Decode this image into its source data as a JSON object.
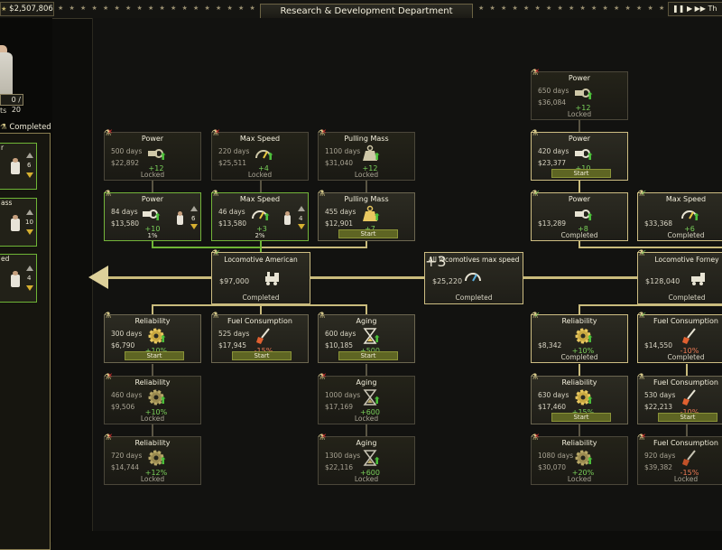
{
  "topbar": {
    "money": "$2,507,806",
    "title": "Research & Development Department",
    "right_label": "Th"
  },
  "left_panel": {
    "staff_count": "0 / 20",
    "text_fragment": "ts",
    "completed_label": "Completed",
    "cards": [
      {
        "title": "r",
        "level": "6"
      },
      {
        "title": "ass",
        "level": "10"
      },
      {
        "title": "ed",
        "level": "4"
      }
    ]
  },
  "nodes": {
    "power_locked": {
      "title": "Power",
      "days": "500 days",
      "cost": "$22,892",
      "gain": "+12",
      "status": "Locked"
    },
    "maxspeed_locked": {
      "title": "Max Speed",
      "days": "220 days",
      "cost": "$25,511",
      "gain": "+4",
      "status": "Locked"
    },
    "pulling_locked": {
      "title": "Pulling Mass",
      "days": "1100 days",
      "cost": "$31,040",
      "gain": "+12",
      "status": "Locked"
    },
    "power_active": {
      "title": "Power",
      "days": "84 days",
      "cost": "$13,580",
      "gain": "+10",
      "staff": "6",
      "progress": "1%"
    },
    "maxspeed_active": {
      "title": "Max Speed",
      "days": "46 days",
      "cost": "$13,580",
      "gain": "+3",
      "staff": "4",
      "progress": "2%"
    },
    "pulling_start": {
      "title": "Pulling Mass",
      "days": "455 days",
      "cost": "$12,901",
      "gain": "+7",
      "button": "Start"
    },
    "loco_american": {
      "title": "Locomotive American",
      "cost": "$97,000",
      "status": "Completed"
    },
    "all_loco": {
      "title": "All locomotives max speed",
      "cost": "$25,220",
      "gain": "+3",
      "status": "Completed"
    },
    "loco_forney": {
      "title": "Locomotive Forney",
      "cost": "$128,040",
      "status": "Completed"
    },
    "rel_start": {
      "title": "Reliability",
      "days": "300 days",
      "cost": "$6,790",
      "gain": "+10%",
      "button": "Start"
    },
    "fuel_start": {
      "title": "Fuel Consumption",
      "days": "525 days",
      "cost": "$17,945",
      "gain": "-15%",
      "button": "Start"
    },
    "aging_start": {
      "title": "Aging",
      "days": "600 days",
      "cost": "$10,185",
      "gain": "+500",
      "button": "Start"
    },
    "rel_locked1": {
      "title": "Reliability",
      "days": "460 days",
      "cost": "$9,506",
      "gain": "+10%",
      "status": "Locked"
    },
    "aging_locked1": {
      "title": "Aging",
      "days": "1000 days",
      "cost": "$17,169",
      "gain": "+600",
      "status": "Locked"
    },
    "rel_locked2": {
      "title": "Reliability",
      "days": "720 days",
      "cost": "$14,744",
      "gain": "+12%",
      "status": "Locked"
    },
    "aging_locked2": {
      "title": "Aging",
      "days": "1300 days",
      "cost": "$22,116",
      "gain": "+600",
      "status": "Locked"
    },
    "r_power_locked": {
      "title": "Power",
      "days": "650 days",
      "cost": "$36,084",
      "gain": "+12",
      "status": "Locked"
    },
    "r_power_start": {
      "title": "Power",
      "days": "420 days",
      "cost": "$23,377",
      "gain": "+10",
      "button": "Start"
    },
    "r_power_done": {
      "title": "Power",
      "cost": "$13,289",
      "gain": "+8",
      "status": "Completed"
    },
    "r_maxspeed_done": {
      "title": "Max Speed",
      "cost": "$33,368",
      "gain": "+6",
      "status": "Completed"
    },
    "r_rel_done": {
      "title": "Reliability",
      "cost": "$8,342",
      "gain": "+10%",
      "status": "Completed"
    },
    "r_fuel_done": {
      "title": "Fuel Consumption",
      "cost": "$14,550",
      "gain": "-10%",
      "status": "Completed"
    },
    "r_rel_start": {
      "title": "Reliability",
      "days": "630 days",
      "cost": "$17,460",
      "gain": "+15%",
      "button": "Start"
    },
    "r_fuel_start": {
      "title": "Fuel Consumption",
      "days": "530 days",
      "cost": "$22,213",
      "gain": "-10%",
      "button": "Start"
    },
    "r_rel_locked": {
      "title": "Reliability",
      "days": "1080 days",
      "cost": "$30,070",
      "gain": "+20%",
      "status": "Locked"
    },
    "r_fuel_locked": {
      "title": "Fuel Consumption",
      "days": "920 days",
      "cost": "$39,382",
      "gain": "-15%",
      "status": "Locked"
    }
  },
  "colors": {
    "accent_gold": "#cdbd82",
    "active_green": "#74b43a",
    "start_button": "#5e6523",
    "gain_positive": "#7ad05a",
    "gain_negative": "#ef7b55"
  }
}
